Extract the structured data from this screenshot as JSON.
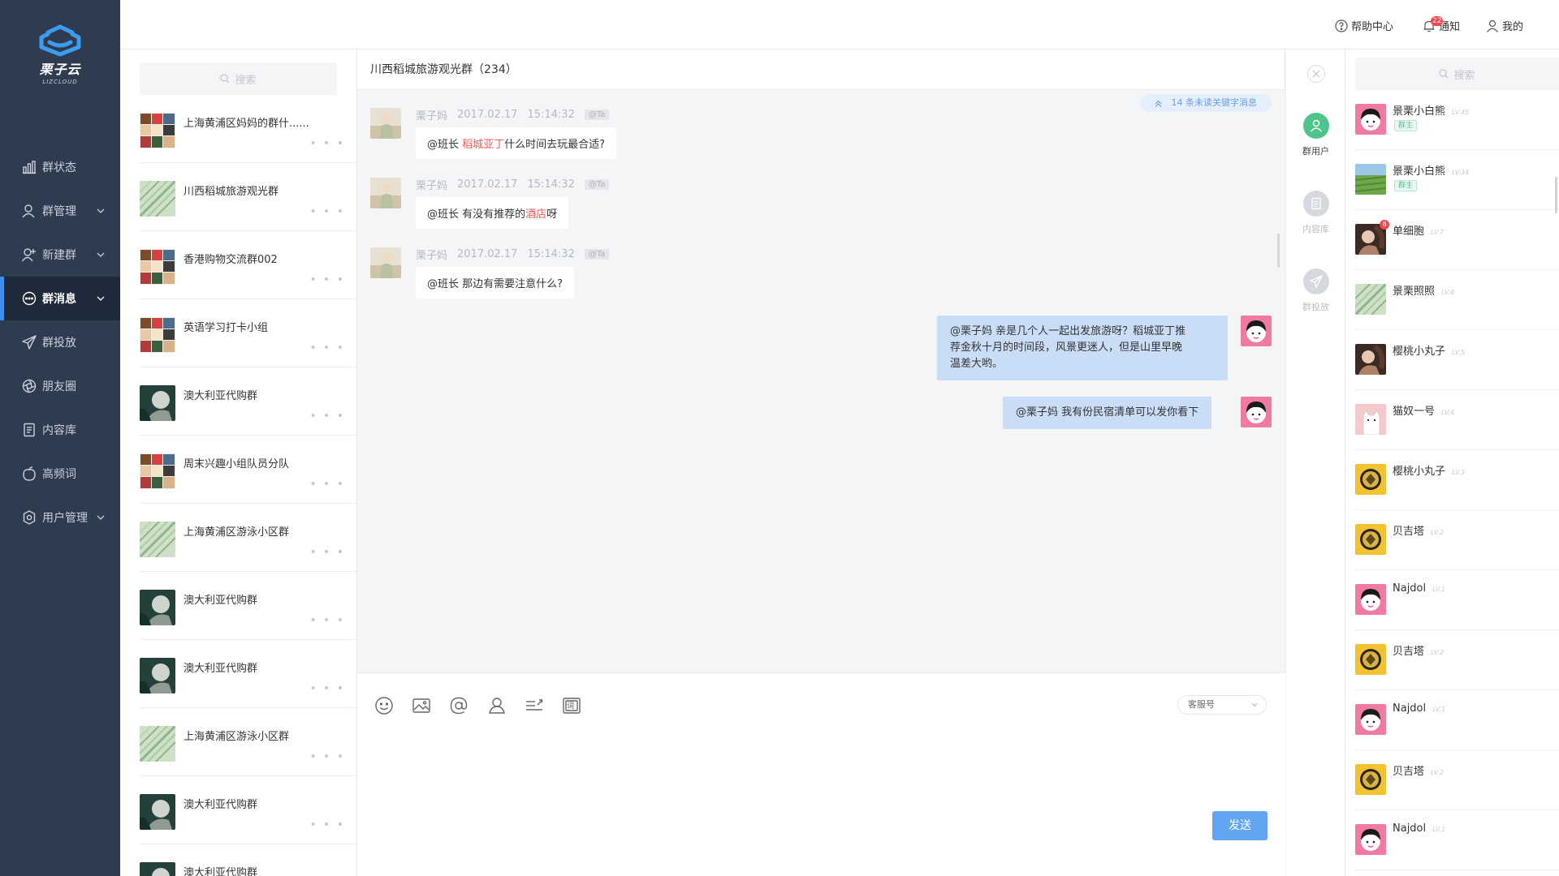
{
  "brand": {
    "name_cn": "栗子云",
    "name_en": "LIZCLOUD",
    "accent": "#3d8ff0"
  },
  "nav": {
    "items": [
      {
        "label": "群状态",
        "icon": "bar-chart-icon",
        "caret": false,
        "active": false
      },
      {
        "label": "群管理",
        "icon": "group-user-icon",
        "caret": true,
        "active": false
      },
      {
        "label": "新建群",
        "icon": "add-user-icon",
        "caret": true,
        "active": false
      },
      {
        "label": "群消息",
        "icon": "chat-bubble-icon",
        "caret": true,
        "active": true
      },
      {
        "label": "群投放",
        "icon": "paper-plane-icon",
        "caret": false,
        "active": false
      },
      {
        "label": "朋友圈",
        "icon": "aperture-icon",
        "caret": false,
        "active": false
      },
      {
        "label": "内容库",
        "icon": "document-icon",
        "caret": false,
        "active": false
      },
      {
        "label": "高频词",
        "icon": "peach-icon",
        "caret": false,
        "active": false
      },
      {
        "label": "用户管理",
        "icon": "user-settings-icon",
        "caret": true,
        "active": false
      }
    ]
  },
  "header": {
    "help": "帮助中心",
    "notify": "通知",
    "notify_count": "22",
    "mine": "我的"
  },
  "group_list": {
    "search_placeholder": "搜索",
    "more": "• • •",
    "items": [
      {
        "name": "上海黄浦区妈妈的群什......",
        "avatar": "collage"
      },
      {
        "name": "川西稻城旅游观光群",
        "avatar": "leaf"
      },
      {
        "name": "香港购物交流群002",
        "avatar": "collage"
      },
      {
        "name": "英语学习打卡小组",
        "avatar": "collage"
      },
      {
        "name": "澳大利亚代购群",
        "avatar": "dark"
      },
      {
        "name": "周末兴趣小组队员分队",
        "avatar": "collage"
      },
      {
        "name": "上海黄浦区游泳小区群",
        "avatar": "leaf"
      },
      {
        "name": "澳大利亚代购群",
        "avatar": "dark"
      },
      {
        "name": "澳大利亚代购群",
        "avatar": "dark"
      },
      {
        "name": "上海黄浦区游泳小区群",
        "avatar": "leaf"
      },
      {
        "name": "澳大利亚代购群",
        "avatar": "dark"
      },
      {
        "name": "澳大利亚代购群",
        "avatar": "dark"
      }
    ]
  },
  "chat": {
    "title": "川西稻城旅游观光群（234）",
    "unread": "14 条未读关键字消息",
    "incoming": [
      {
        "sender": "栗子妈",
        "date": "2017.02.17",
        "time": "15:14:32",
        "tag": "@Ta",
        "pre": "@班长 ",
        "keyword": "稻城亚丁",
        "post": "什么时间去玩最合适?"
      },
      {
        "sender": "栗子妈",
        "date": "2017.02.17",
        "time": "15:14:32",
        "tag": "@Ta",
        "pre": "@班长 有没有推荐的",
        "keyword": "酒店",
        "post": "呀"
      },
      {
        "sender": "栗子妈",
        "date": "2017.02.17",
        "time": "15:14:32",
        "tag": "@Ta",
        "pre": "@班长 那边有需要注意什么?",
        "keyword": "",
        "post": ""
      }
    ],
    "outgoing": [
      {
        "line1": "@栗子妈 亲是几个人一起出发旅游呀？稻城亚丁推",
        "line2": "荐金秋十月的时间段，风景更迷人，但是山里早晚",
        "line3": "温差大哟。"
      },
      {
        "text": "@栗子妈 我有份民宿清单可以发你看下"
      }
    ],
    "toolbar_icons": [
      "smile-icon",
      "image-icon",
      "at-icon",
      "contact-icon",
      "quick-reply-icon",
      "keyword-icon"
    ],
    "keyword_tool_glyph": "词",
    "account_select": "客服号",
    "send_label": "发送"
  },
  "rail": {
    "group_users": "群用户",
    "content_lib": "内容库",
    "group_push": "群投放",
    "active_color": "#4cc48a"
  },
  "members": {
    "search_placeholder": "搜索",
    "items": [
      {
        "name": "景栗小白熊",
        "level": "LV.45",
        "role": "群主",
        "avatar": "girl",
        "badge": ""
      },
      {
        "name": "景栗小白熊",
        "level": "LV.34",
        "role": "群主",
        "avatar": "field",
        "badge": ""
      },
      {
        "name": "单细胞",
        "level": "LV.7",
        "role": "",
        "avatar": "photo",
        "badge": "8"
      },
      {
        "name": "景栗照照",
        "level": "LV.6",
        "role": "",
        "avatar": "leaf",
        "badge": ""
      },
      {
        "name": "樱桃小丸子",
        "level": "LV.5",
        "role": "",
        "avatar": "photo",
        "badge": ""
      },
      {
        "name": "猫奴一号",
        "level": "LV.4",
        "role": "",
        "avatar": "cat",
        "badge": ""
      },
      {
        "name": "樱桃小丸子",
        "level": "LV.3",
        "role": "",
        "avatar": "coin",
        "badge": ""
      },
      {
        "name": "贝吉塔",
        "level": "LV.2",
        "role": "",
        "avatar": "coin",
        "badge": ""
      },
      {
        "name": "Najdol",
        "level": "LV.1",
        "role": "",
        "avatar": "girl",
        "badge": ""
      },
      {
        "name": "贝吉塔",
        "level": "LV.2",
        "role": "",
        "avatar": "coin",
        "badge": ""
      },
      {
        "name": "Najdol",
        "level": "LV.1",
        "role": "",
        "avatar": "girl",
        "badge": ""
      },
      {
        "name": "贝吉塔",
        "level": "LV.2",
        "role": "",
        "avatar": "coin",
        "badge": ""
      },
      {
        "name": "Najdol",
        "level": "LV.1",
        "role": "",
        "avatar": "girl",
        "badge": ""
      }
    ]
  }
}
